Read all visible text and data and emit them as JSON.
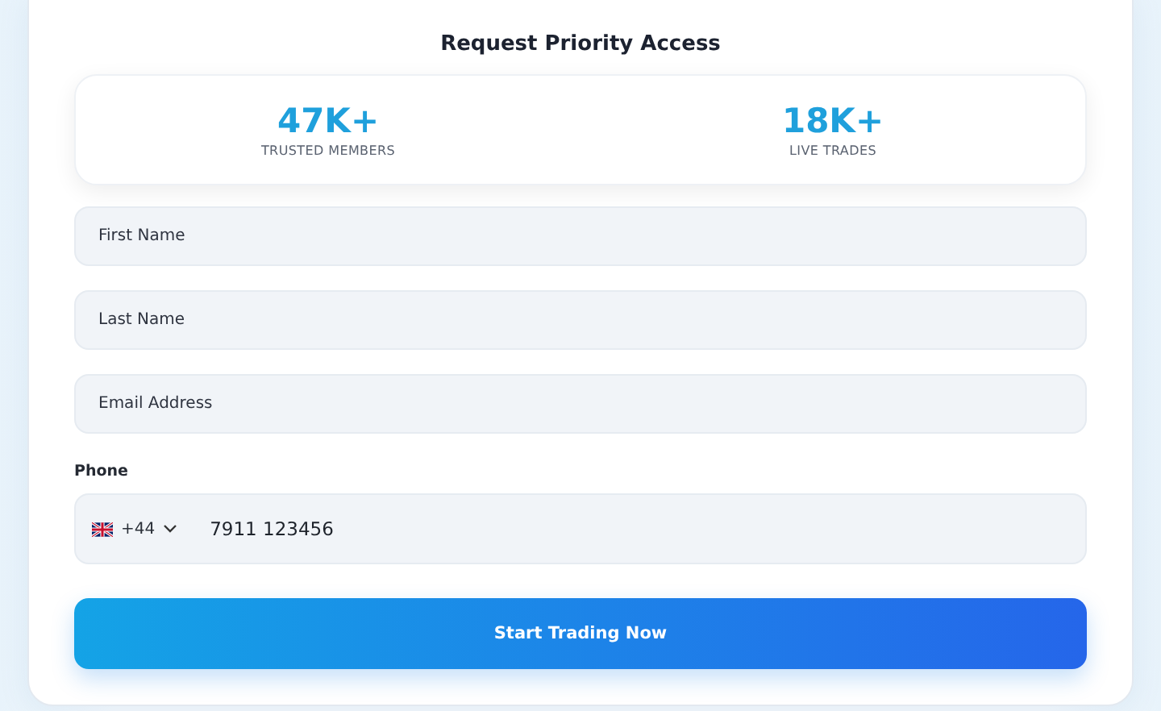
{
  "form": {
    "title": "Request Priority Access",
    "stats": [
      {
        "value": "47K+",
        "label": "TRUSTED MEMBERS"
      },
      {
        "value": "18K+",
        "label": "LIVE TRADES"
      }
    ],
    "fields": [
      {
        "placeholder": "First Name"
      },
      {
        "placeholder": "Last Name"
      },
      {
        "placeholder": "Email Address"
      }
    ],
    "phone": {
      "label": "Phone",
      "country_code": "+44",
      "value": "7911 123456"
    },
    "submit": "Start Trading Now"
  }
}
